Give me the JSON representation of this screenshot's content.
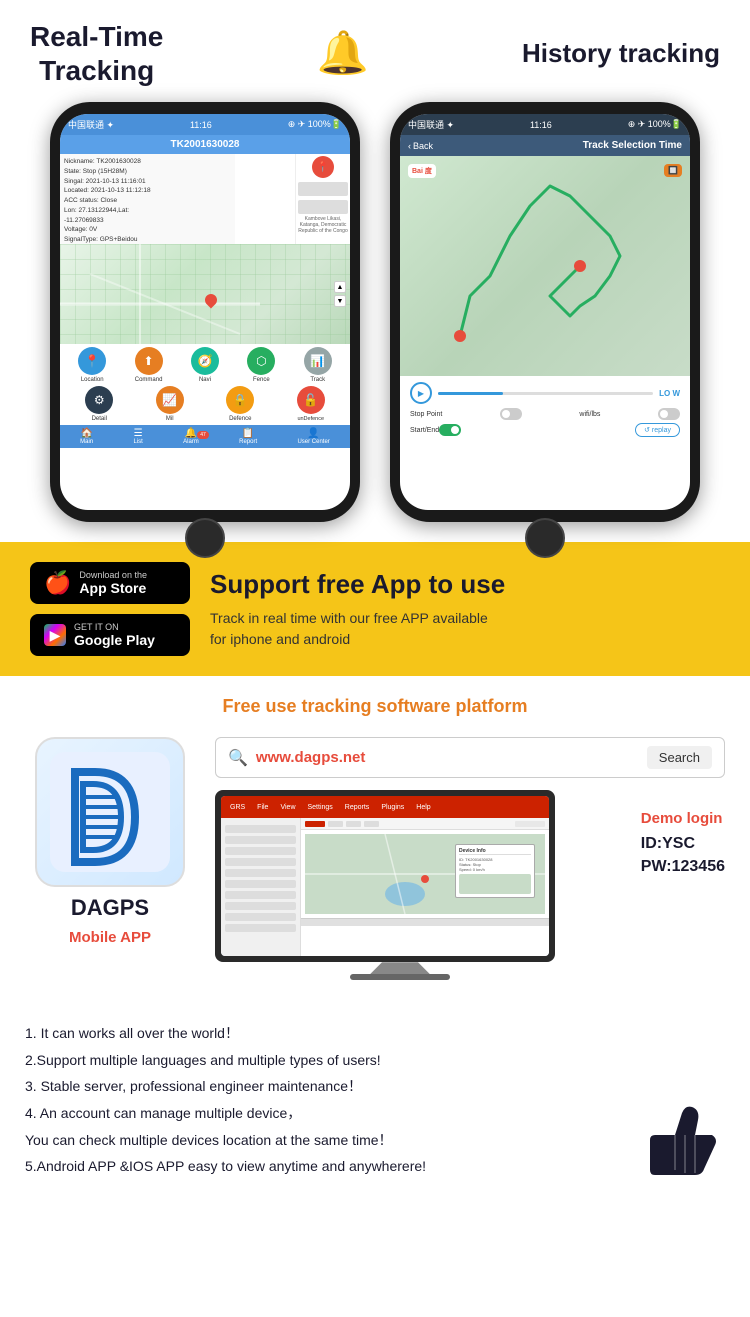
{
  "top": {
    "real_time_title": "Real-Time\nTracking",
    "bell": "🔔",
    "history_title": "History tracking"
  },
  "phone1": {
    "status_bar": "中国联通 ✦  11:16  ⊕ ✈ 100% 🔋",
    "device_id": "TK2001630028",
    "info_lines": "Nickname: TK2001630028\nState: Stop (15H28M)\nSingal: 2021-10-13 11:16:01\nLocated: 2021-10-13 11:12:18\nACC status: Close\nLon: 27.13122944,Lat: -11.27069833\nVoltage: 0V\nSignalType: GPS+Beidou",
    "location_label": "Location",
    "command_label": "Command",
    "navi_label": "Navi",
    "fence_label": "Fence",
    "track_label": "Track",
    "detail_label": "Detail",
    "mil_label": "Mil",
    "defence_label": "Defence",
    "undefence_label": "unDefence",
    "nav_main": "Main",
    "nav_list": "List",
    "nav_alarm": "Alarm",
    "nav_report": "Report",
    "nav_user": "User Center"
  },
  "phone2": {
    "status_bar": "中国联通 ✦  11:16  ⊕ ✈ 100% 🔋",
    "back_label": "Back",
    "track_title": "Track Selection Time",
    "stop_point_label": "Stop Point",
    "wifi_lbs_label": "wifi/lbs",
    "start_end_label": "Start/End",
    "replay_label": "↺ replay",
    "speed_label": "LO W"
  },
  "yellow_section": {
    "app_store_line1": "Download on the",
    "app_store_line2": "App Store",
    "google_play_line1": "GET IT ON",
    "google_play_line2": "Google Play",
    "support_title": "Support free App to use",
    "support_desc": "Track in real time with our free APP available\nfor iphone and android"
  },
  "platform_section": {
    "title": "Free use tracking software platform",
    "search_url": "www.dagps.net",
    "search_btn": "Search",
    "app_name": "DAGPS",
    "mobile_app_label": "Mobile APP",
    "demo_login": "Demo login",
    "demo_id": "ID:YSC",
    "demo_pw": "PW:123456"
  },
  "features": {
    "lines": [
      "1. It can works all over the world！",
      "2.Support multiple languages and multiple types of users!",
      "3. Stable server, professional engineer maintenance！",
      "4. An account can manage multiple device，",
      "You can check multiple devices location at the same time！",
      "5.Android APP &IOS APP easy to view anytime and anywherere!"
    ]
  }
}
